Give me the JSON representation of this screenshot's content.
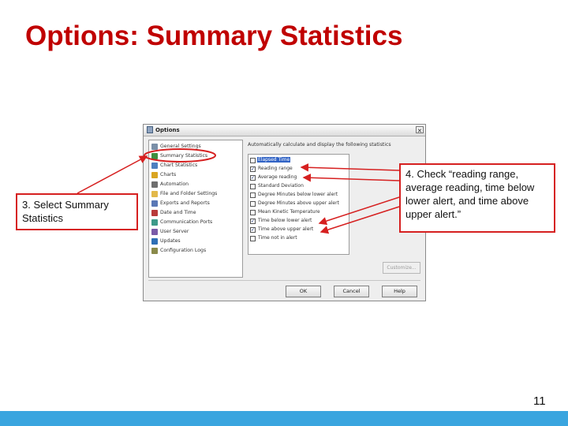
{
  "slide": {
    "title": "Options: Summary Statistics",
    "callout_left": "3. Select Summary Statistics",
    "callout_right": "4. Check “reading range, average reading, time below lower alert, and time above upper alert.”",
    "page_number": "11",
    "title_color": "#c00000",
    "callout_border_color": "#d62020",
    "footer_color": "#3aa5df"
  },
  "dialog": {
    "title": "Options",
    "close_label": "×",
    "description": "Automatically calculate and display the following statistics",
    "nav_items": [
      {
        "label": "General Settings",
        "icon": "general-settings-icon"
      },
      {
        "label": "Summary Statistics",
        "icon": "summary-statistics-icon"
      },
      {
        "label": "Chart Statistics",
        "icon": "chart-statistics-icon"
      },
      {
        "label": "Charts",
        "icon": "charts-icon"
      },
      {
        "label": "Automation",
        "icon": "automation-icon"
      },
      {
        "label": "File and Folder Settings",
        "icon": "folder-icon"
      },
      {
        "label": "Exports and Reports",
        "icon": "exports-icon"
      },
      {
        "label": "Date and Time",
        "icon": "calendar-icon"
      },
      {
        "label": "Communication Ports",
        "icon": "ports-icon"
      },
      {
        "label": "User Server",
        "icon": "user-server-icon"
      },
      {
        "label": "Updates",
        "icon": "updates-icon"
      },
      {
        "label": "Configuration Logs",
        "icon": "logs-icon"
      }
    ],
    "statistics": [
      {
        "label": "Elapsed Time",
        "checked": false
      },
      {
        "label": "Reading range",
        "checked": true
      },
      {
        "label": "Average reading",
        "checked": true
      },
      {
        "label": "Standard Deviation",
        "checked": false
      },
      {
        "label": "Degree Minutes below lower alert",
        "checked": false
      },
      {
        "label": "Degree Minutes above upper alert",
        "checked": false
      },
      {
        "label": "Mean Kinetic Temperature",
        "checked": false
      },
      {
        "label": "Time below lower alert",
        "checked": true
      },
      {
        "label": "Time above upper alert",
        "checked": true
      },
      {
        "label": "Time not in alert",
        "checked": false
      }
    ],
    "customize_label": "Customize...",
    "ok_label": "OK",
    "cancel_label": "Cancel",
    "help_label": "Help"
  }
}
